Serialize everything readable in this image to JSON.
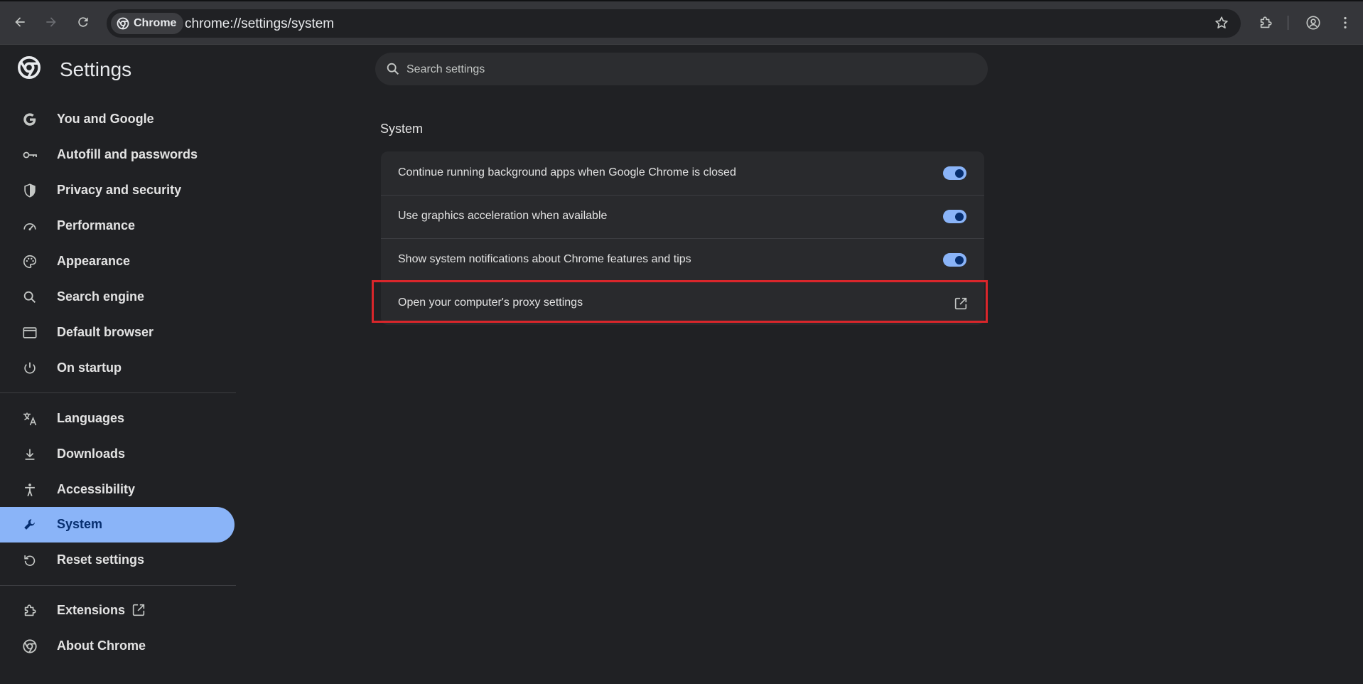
{
  "browser": {
    "chip_label": "Chrome",
    "url": "chrome://settings/system"
  },
  "sidebar": {
    "title": "Settings",
    "items": [
      {
        "label": "You and Google",
        "icon": "google-g-icon"
      },
      {
        "label": "Autofill and passwords",
        "icon": "key-icon"
      },
      {
        "label": "Privacy and security",
        "icon": "shield-icon"
      },
      {
        "label": "Performance",
        "icon": "speedometer-icon"
      },
      {
        "label": "Appearance",
        "icon": "palette-icon"
      },
      {
        "label": "Search engine",
        "icon": "search-icon"
      },
      {
        "label": "Default browser",
        "icon": "browser-window-icon"
      },
      {
        "label": "On startup",
        "icon": "power-icon"
      },
      {
        "label": "Languages",
        "icon": "translate-icon"
      },
      {
        "label": "Downloads",
        "icon": "download-icon"
      },
      {
        "label": "Accessibility",
        "icon": "accessibility-icon"
      },
      {
        "label": "System",
        "icon": "wrench-icon",
        "active": true
      },
      {
        "label": "Reset settings",
        "icon": "reset-icon"
      },
      {
        "label": "Extensions",
        "icon": "puzzle-icon"
      },
      {
        "label": "About Chrome",
        "icon": "chrome-logo-icon"
      }
    ]
  },
  "search": {
    "placeholder": "Search settings"
  },
  "main": {
    "section_title": "System",
    "rows": [
      {
        "label": "Continue running background apps when Google Chrome is closed",
        "control": "toggle",
        "checked": true
      },
      {
        "label": "Use graphics acceleration when available",
        "control": "toggle",
        "checked": true
      },
      {
        "label": "Show system notifications about Chrome features and tips",
        "control": "toggle",
        "checked": true
      },
      {
        "label": "Open your computer's proxy settings",
        "control": "external-link"
      }
    ]
  },
  "colors": {
    "accent": "#8ab4f8",
    "highlight_box": "#d9262b",
    "background": "#202124"
  }
}
